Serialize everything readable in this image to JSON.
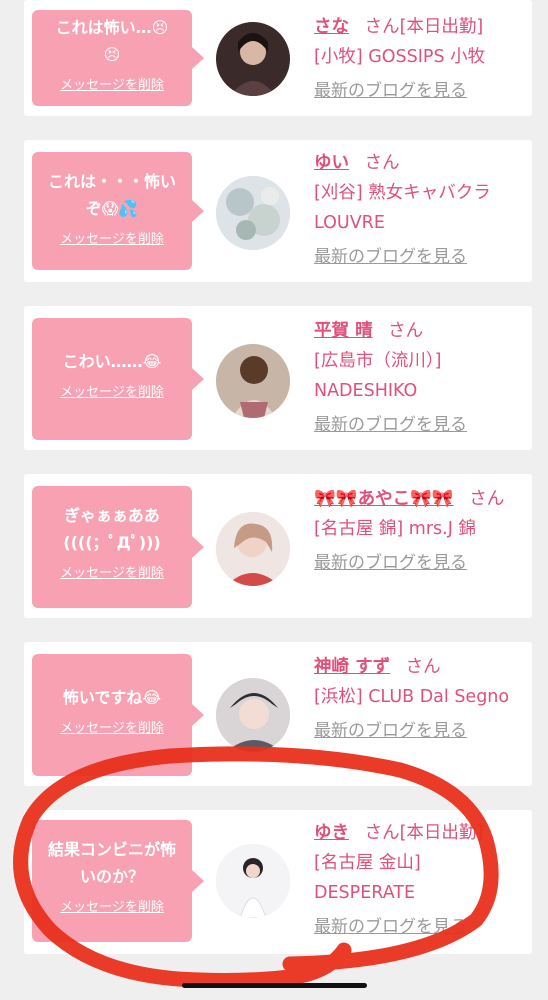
{
  "entries": [
    {
      "message": "これは怖い…😣\n😣",
      "delete_label": "メッセージを削除",
      "name": "さな",
      "san": "さん",
      "status": "[本日出勤]",
      "shop": "[小牧] GOSSIPS 小牧",
      "blog_label": "最新のブログを見る",
      "avatar": "avatar-photo-dark-hair"
    },
    {
      "message": "これは・・・怖い\nぞ😱💦",
      "delete_label": "メッセージを削除",
      "name": "ゆい",
      "san": "さん",
      "status": "",
      "shop": "[刈谷] 熟女キャバクラ LOUVRE",
      "blog_label": "最新のブログを見る",
      "avatar": "avatar-photo-flowers"
    },
    {
      "message": "こわい……😂",
      "delete_label": "メッセージを削除",
      "name": "平賀 晴",
      "san": "さん",
      "status": "",
      "shop": "[広島市（流川）] NADESHIKO",
      "blog_label": "最新のブログを見る",
      "avatar": "avatar-photo-kimono"
    },
    {
      "message": "ぎゃぁぁああ\n((((；ﾟДﾟ)))",
      "delete_label": "メッセージを削除",
      "name": "🎀🎀あやこ🎀🎀",
      "san": "さん",
      "status": "",
      "shop": "[名古屋 錦] mrs.J 錦",
      "blog_label": "最新のブログを見る",
      "avatar": "avatar-photo-portrait"
    },
    {
      "message": "怖いですね😂",
      "delete_label": "メッセージを削除",
      "name": "神崎 すず",
      "san": "さん",
      "status": "",
      "shop": "[浜松] CLUB Dal Segno",
      "blog_label": "最新のブログを見る",
      "avatar": "avatar-photo-headdress"
    },
    {
      "message": "結果コンビニが怖\nいのか？",
      "delete_label": "メッセージを削除",
      "name": "ゆき",
      "san": "さん",
      "status": "[本日出勤]",
      "shop": "[名古屋 金山] DESPERATE",
      "blog_label": "最新のブログを見る",
      "avatar": "avatar-photo-white-dress"
    }
  ],
  "colors": {
    "accent_pink": "#e0507a",
    "bubble_pink": "#f8a1b3",
    "background": "#efefef",
    "annotation_red": "#e8301c"
  }
}
